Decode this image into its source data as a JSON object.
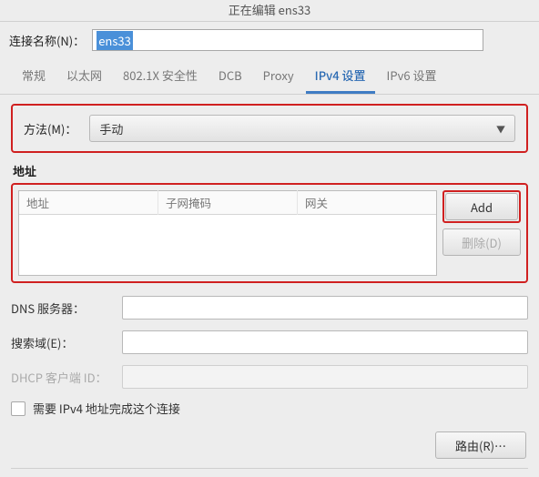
{
  "title": "正在编辑 ens33",
  "name_row": {
    "label": "连接名称(N)：",
    "value": "ens33"
  },
  "tabs": {
    "items": [
      {
        "label": "常规"
      },
      {
        "label": "以太网"
      },
      {
        "label": "802.1X 安全性"
      },
      {
        "label": "DCB"
      },
      {
        "label": "Proxy"
      },
      {
        "label": "IPv4 设置"
      },
      {
        "label": "IPv6 设置"
      }
    ],
    "active_index": 5
  },
  "method": {
    "label": "方法(M)：",
    "value": "手动"
  },
  "addresses": {
    "title": "地址",
    "columns": [
      "地址",
      "子网掩码",
      "网关"
    ],
    "rows": [],
    "add_label": "Add",
    "delete_label": "删除(D)"
  },
  "dns": {
    "label": "DNS 服务器：",
    "value": ""
  },
  "search": {
    "label": "搜索域(E)：",
    "value": ""
  },
  "dhcp": {
    "label": "DHCP 客户端 ID：",
    "value": "",
    "enabled": false
  },
  "require_check": {
    "label": "需要 IPv4 地址完成这个连接",
    "checked": false
  },
  "routes_label": "路由(R)…"
}
